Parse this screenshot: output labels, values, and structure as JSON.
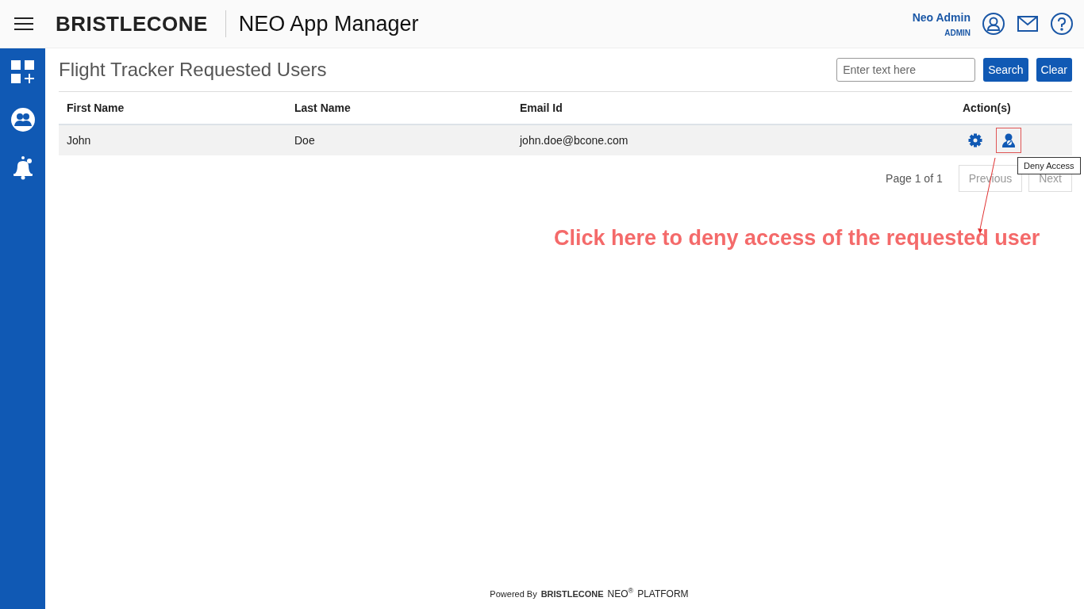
{
  "header": {
    "logo": "BRISTLECONE",
    "app_title": "NEO App Manager",
    "user_name": "Neo Admin",
    "user_role": "ADMIN"
  },
  "page_title": "Flight Tracker Requested Users",
  "search": {
    "placeholder": "Enter text here",
    "buttons": [
      "Search",
      "Clear"
    ]
  },
  "table": {
    "columns": [
      "First Name",
      "Last Name",
      "Email Id",
      "Action(s)"
    ],
    "rows": [
      {
        "cells": [
          "John",
          "Doe",
          "john.doe@bcone.com"
        ]
      }
    ]
  },
  "pagination": {
    "info": "Page 1 of 1",
    "buttons": [
      "Previous",
      "Next"
    ]
  },
  "tooltip": "Deny Access",
  "annotation": "Click here to deny access of the requested user",
  "footer": {
    "prefix": "Powered By",
    "logo": "BRISTLECONE",
    "product": "NEO",
    "mark": "®",
    "suffix": "PLATFORM"
  }
}
